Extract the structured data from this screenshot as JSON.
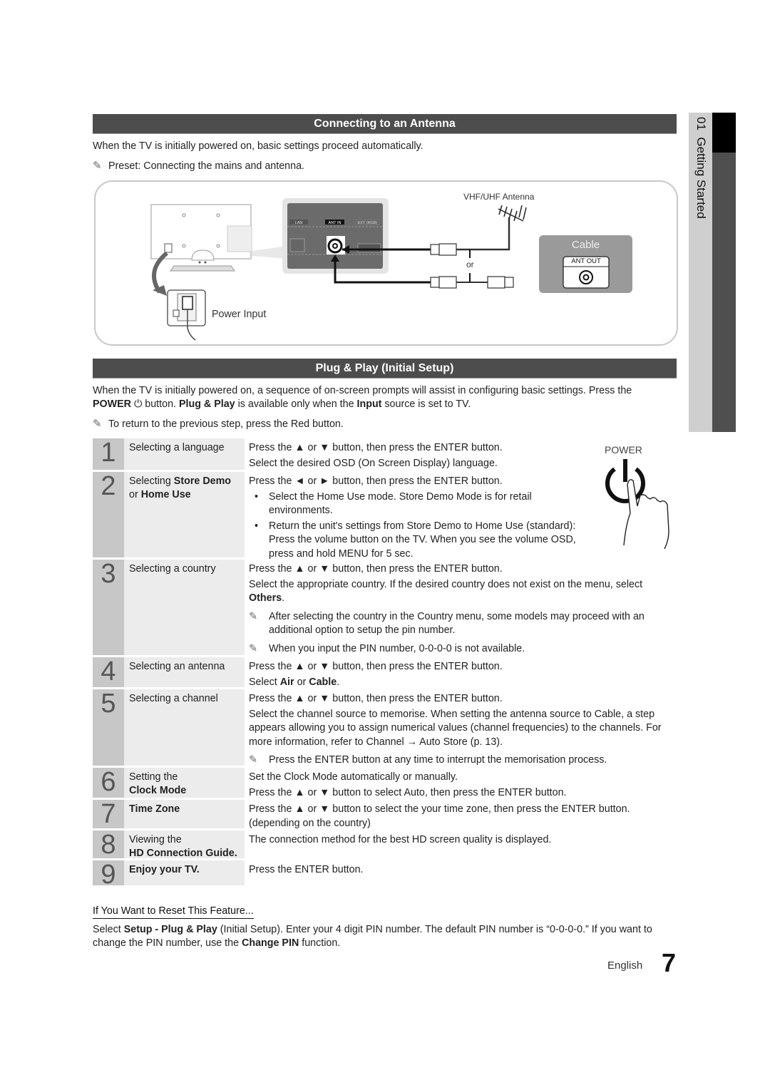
{
  "side_tab": {
    "chapter": "01",
    "title": "Getting Started"
  },
  "antenna_section": {
    "heading": "Connecting to an Antenna",
    "intro": "When the TV is initially powered on, basic settings proceed automatically.",
    "note": "Preset: Connecting the mains and antenna.",
    "diagram": {
      "port_labels": [
        "LAN",
        "ANT IN",
        "EXT (RGB)"
      ],
      "antenna_label": "VHF/UHF Antenna",
      "or_label": "or",
      "cable_label": "Cable",
      "ant_out_label": "ANT OUT",
      "power_input_label": "Power Input"
    }
  },
  "plug_play_section": {
    "heading": "Plug & Play (Initial Setup)",
    "intro_1": "When the TV is initially powered on, a sequence of on-screen prompts will assist in configuring basic settings. Press the",
    "intro_power": "POWER",
    "intro_2": " button. ",
    "intro_pp": "Plug & Play",
    "intro_3": " is available only when the ",
    "intro_input": "Input",
    "intro_4": " source is set to TV.",
    "note": "To return to the previous step, press the Red button.",
    "power_illustration_label": "POWER"
  },
  "steps": [
    {
      "num": "1",
      "title": "Selecting a language",
      "lines": [
        "Press the ▲ or ▼ button, then press the ENTER button.",
        "Select the desired OSD (On Screen Display) language."
      ]
    },
    {
      "num": "2",
      "title_a": "Selecting ",
      "title_b": "Store Demo",
      "title_c": "or ",
      "title_d": "Home Use",
      "line1": "Press the ◄ or ► button, then press the ENTER button.",
      "bullet1": "Select the Home Use mode. Store Demo Mode is for retail environments.",
      "bullet2": "Return the unit's settings from Store Demo to Home Use (standard): Press the volume button on the TV. When you see the volume OSD, press and hold MENU for 5 sec."
    },
    {
      "num": "3",
      "title": "Selecting a country",
      "line1": "Press the ▲ or ▼ button, then press the ENTER button.",
      "line2": "Select the appropriate country. If the desired country does not exist on the menu, select",
      "line2_bold": "Others",
      "note1": "After selecting the country in the Country menu, some models may proceed with an additional option to setup the pin number.",
      "note2": "When you input the PIN number, 0-0-0-0 is not available."
    },
    {
      "num": "4",
      "title": "Selecting an antenna",
      "line1": "Press the ▲ or ▼ button, then press the ENTER button.",
      "line2_a": "Select ",
      "line2_air": "Air",
      "line2_or": " or ",
      "line2_cable": "Cable"
    },
    {
      "num": "5",
      "title": "Selecting a channel",
      "line1": "Press the ▲ or ▼ button, then press the ENTER button.",
      "line2": "Select the channel source to memorise. When setting the antenna source to Cable, a step appears allowing you to assign numerical values (channel frequencies) to the channels. For more information, refer to Channel → Auto Store (p. 13).",
      "note": "Press the ENTER button at any time to interrupt the memorisation process."
    },
    {
      "num": "6",
      "title_a": "Setting the",
      "title_b": "Clock Mode",
      "line1": "Set the Clock Mode automatically or manually.",
      "line2": "Press the ▲ or ▼ button to select Auto, then press the ENTER button."
    },
    {
      "num": "7",
      "title": "Time Zone",
      "line1": "Press the ▲ or ▼ button to select the your time zone, then press the ENTER button. (depending on the country)"
    },
    {
      "num": "8",
      "title_a": "Viewing the",
      "title_b": "HD Connection Guide.",
      "line1": "The connection method for the best HD screen quality is displayed."
    },
    {
      "num": "9",
      "title": "Enjoy your TV.",
      "line1": "Press the ENTER button."
    }
  ],
  "reset": {
    "heading": "If You Want to Reset This Feature...",
    "text_a": "Select ",
    "text_b": "Setup - Plug & Play",
    "text_c": " (Initial Setup). Enter your 4 digit PIN number. The default PIN number is “0-0-0-0.” If you want to change the PIN number, use the ",
    "text_d": "Change PIN",
    "text_e": " function."
  },
  "footer": {
    "language": "English",
    "page": "7"
  },
  "colors": {
    "section_bar": "#4d4d4d",
    "step_number_bg": "#c7c7c7",
    "step_title_bg": "#ececec",
    "side_tab_dark": "#4f4f4f",
    "side_tab_light": "#cfcfcf"
  }
}
